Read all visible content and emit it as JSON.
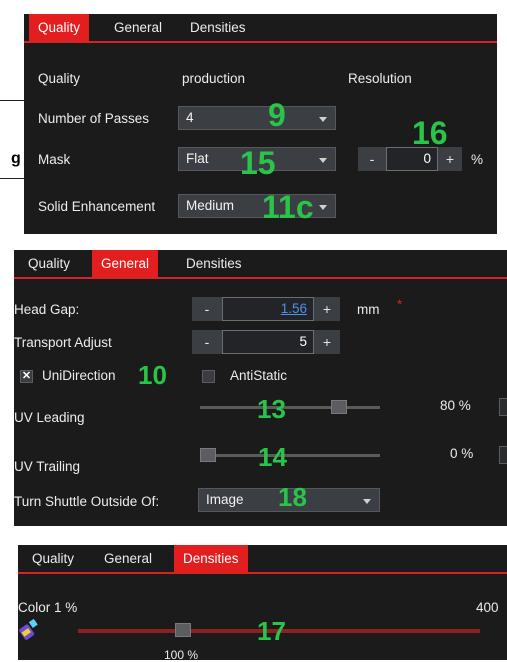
{
  "quality_panel": {
    "tabs": [
      "Quality",
      "General",
      "Densities"
    ],
    "quality_label": "Quality",
    "quality_value": "production",
    "resolution_label": "Resolution",
    "passes_label": "Number of Passes",
    "passes_value": "4",
    "mask_label": "Mask",
    "mask_value": "Flat",
    "resolution_minus": "-",
    "resolution_value": "0",
    "resolution_plus": "+",
    "resolution_unit": "%",
    "solid_label": "Solid Enhancement",
    "solid_value": "Medium",
    "outside_fragment": "g",
    "annotations": {
      "passes": "9",
      "resolution": "16",
      "mask": "15",
      "solid": "11c"
    }
  },
  "general_panel": {
    "tabs": [
      "Quality",
      "General",
      "Densities"
    ],
    "head_gap_label": "Head Gap:",
    "head_gap_minus": "-",
    "head_gap_value": "1.56",
    "head_gap_plus": "+",
    "head_gap_unit": "mm",
    "head_gap_marker": "*",
    "transport_label": "Transport Adjust",
    "transport_minus": "-",
    "transport_value": "5",
    "transport_plus": "+",
    "unidirection_label": "UniDirection",
    "unidirection_checked": true,
    "antistatic_label": "AntiStatic",
    "antistatic_checked": false,
    "uv_leading_label": "UV Leading",
    "uv_leading_value": "80 %",
    "uv_leading_level": 0.8,
    "uv_trailing_label": "UV Trailing",
    "uv_trailing_value": "0 %",
    "uv_trailing_level": 0.0,
    "shuttle_label": "Turn Shuttle Outside Of:",
    "shuttle_value": "Image",
    "annotations": {
      "unidirection": "10",
      "uv_leading": "13",
      "uv_trailing": "14",
      "shuttle": "18"
    }
  },
  "densities_panel": {
    "tabs": [
      "Quality",
      "General",
      "Densities"
    ],
    "color_label": "Color 1 %",
    "color_max": "400",
    "color_value": "100 %",
    "color_level": 0.25,
    "annotations": {
      "color": "17"
    }
  },
  "colors": {
    "accent": "#e31e1e",
    "annotation": "#2ac44a",
    "panel_bg": "#1b1b1b"
  },
  "icons": [
    "dropdown-arrow-icon",
    "checkbox-check-icon",
    "spray-bottle-icon"
  ]
}
